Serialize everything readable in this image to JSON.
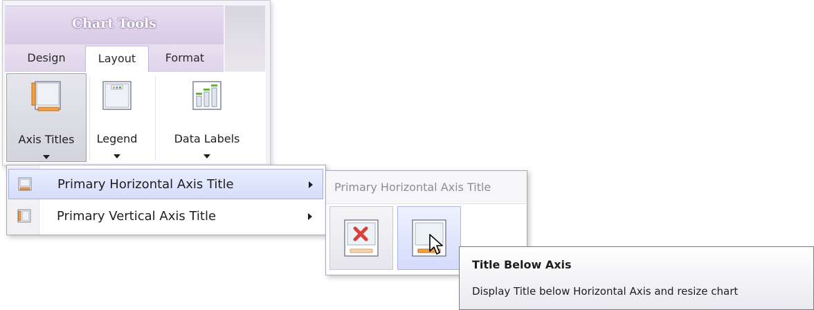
{
  "ribbon": {
    "contextual_header": "Chart Tools",
    "tabs": [
      {
        "label": "Design",
        "active": false
      },
      {
        "label": "Layout",
        "active": true
      },
      {
        "label": "Format",
        "active": false
      }
    ],
    "buttons": [
      {
        "label": "Axis Titles",
        "icon": "axis-titles-icon",
        "pressed": true
      },
      {
        "label": "Legend",
        "icon": "legend-icon",
        "pressed": false
      },
      {
        "label": "Data Labels",
        "icon": "data-labels-icon",
        "pressed": false
      }
    ]
  },
  "menu": {
    "items": [
      {
        "label": "Primary Horizontal Axis Title",
        "icon": "horizontal-axis-title-icon",
        "highlighted": true
      },
      {
        "label": "Primary Vertical Axis Title",
        "icon": "vertical-axis-title-icon",
        "highlighted": false
      }
    ]
  },
  "gallery": {
    "header": "Primary Horizontal Axis Title",
    "items": [
      {
        "icon": "none-icon",
        "hovered": false
      },
      {
        "icon": "title-below-axis-icon",
        "hovered": true
      }
    ]
  },
  "tooltip": {
    "title": "Title Below Axis",
    "description": "Display Title below Horizontal Axis and resize chart"
  },
  "colors": {
    "contextual_tab": "#dacdea",
    "hover_blue": "#d5ddf9",
    "title_orange": "#f0a046"
  }
}
